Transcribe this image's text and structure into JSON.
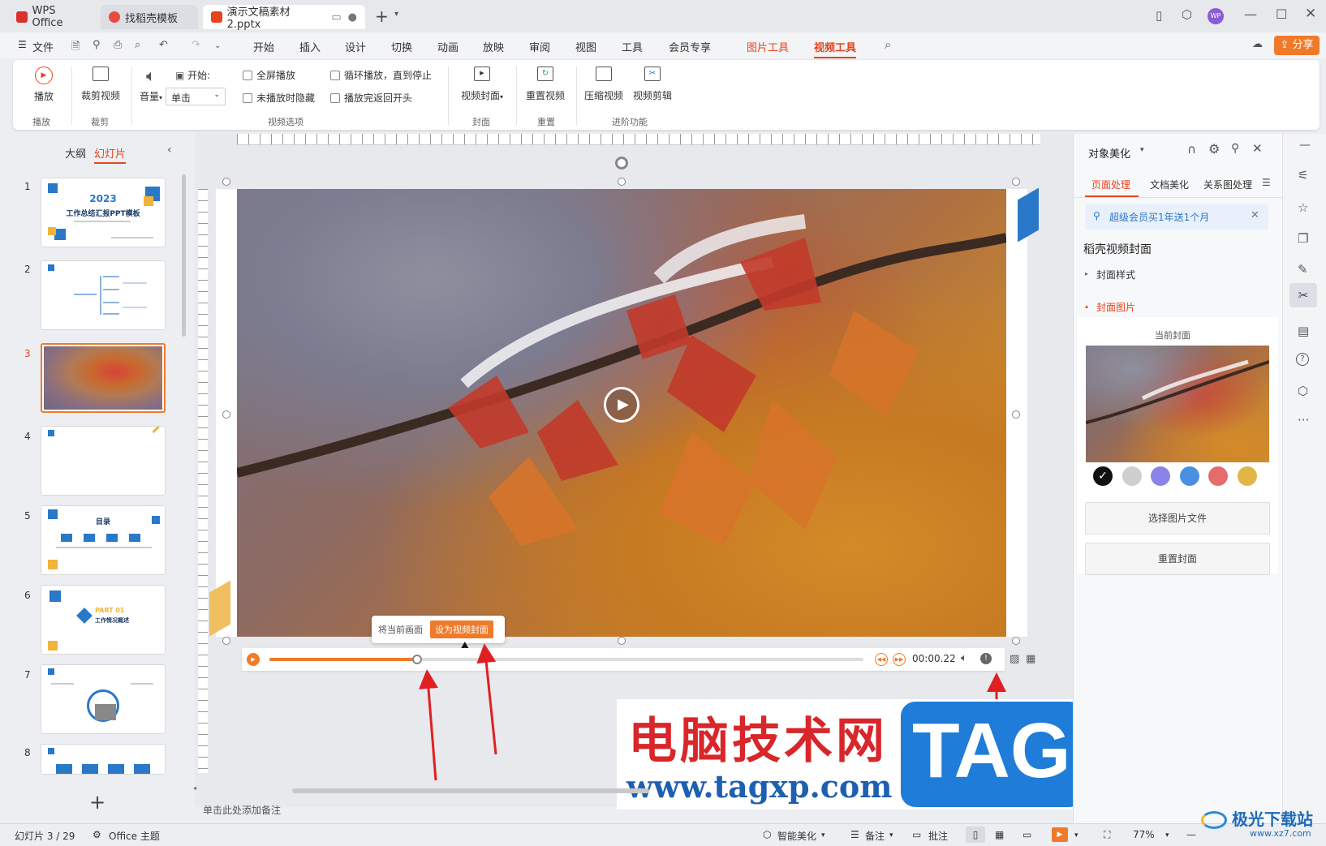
{
  "tabs": [
    {
      "label": "WPS Office",
      "icon": "wps-logo-icon",
      "color": "#d9302c"
    },
    {
      "label": "找稻壳模板",
      "icon": "docer-icon",
      "color": "#e84c3d"
    },
    {
      "label": "演示文稿素材2.pptx",
      "icon": "ppt-icon",
      "color": "#e8431c"
    }
  ],
  "titlebar": {
    "avatar": "WP"
  },
  "menu": {
    "file": "文件",
    "items": [
      "开始",
      "插入",
      "设计",
      "切换",
      "动画",
      "放映",
      "审阅",
      "视图",
      "工具",
      "会员专享"
    ],
    "context_tabs": [
      "图片工具",
      "视频工具"
    ],
    "share": "分享"
  },
  "ribbon": {
    "play": "播放",
    "play_group": "播放",
    "trim": "裁剪视频",
    "trim_group": "裁剪",
    "volume": "音量",
    "start_label": "开始:",
    "start_value": "单击",
    "fullscreen": "全屏播放",
    "hide_not_playing": "未播放时隐藏",
    "loop": "循环播放，直到停止",
    "rewind": "播放完返回开头",
    "options_group": "视频选项",
    "cover": "视频封面",
    "cover_group": "封面",
    "reset": "重置视频",
    "reset_group": "重置",
    "compress": "压缩视频",
    "edit": "视频剪辑",
    "advanced_group": "进阶功能"
  },
  "leftpanel": {
    "outline_tab": "大纲",
    "slides_tab": "幻灯片",
    "slide_numbers": [
      "1",
      "2",
      "3",
      "4",
      "5",
      "6",
      "7",
      "8"
    ],
    "slide1_year": "2023",
    "slide1_title": "工作总结汇报PPT模板",
    "slide5_title": "目录",
    "slide6_part": "PART 01",
    "slide6_title": "工作情况概述"
  },
  "player": {
    "time": "00:00.22",
    "progress": 0.248,
    "tooltip_label": "将当前画面",
    "tooltip_button": "设为视频封面"
  },
  "notes_placeholder": "单击此处添加备注",
  "rightpanel": {
    "title": "对象美化",
    "tabs": [
      "页面处理",
      "文档美化",
      "关系图处理"
    ],
    "promo": "超级会员买1年送1个月",
    "section_title": "稻壳视频封面",
    "cover_style": "封面样式",
    "cover_image": "封面图片",
    "current_cover": "当前封面",
    "colors": [
      "#111111",
      "#cfcfcf",
      "#8a84e8",
      "#4a90e2",
      "#e46c6c",
      "#e2b54a"
    ],
    "choose_file": "选择图片文件",
    "reset_cover": "重置封面"
  },
  "statusbar": {
    "slide_info": "幻灯片 3 / 29",
    "theme": "Office 主题",
    "smart": "智能美化",
    "notes": "备注",
    "comments": "批注",
    "zoom": "77%"
  },
  "watermark": {
    "cn": "电脑技术网",
    "url": "www.tagxp.com",
    "tag": "TAG",
    "site2": "极光下载站",
    "site2_url": "www.xz7.com"
  }
}
